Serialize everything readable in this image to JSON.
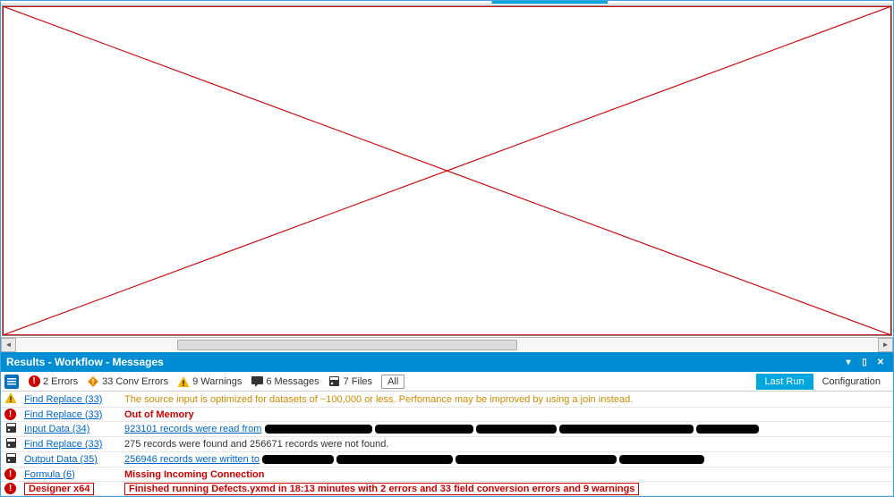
{
  "panel_title": "Results - Workflow - Messages",
  "filters": {
    "errors": "2 Errors",
    "conv": "33 Conv Errors",
    "warnings": "9 Warnings",
    "messages": "6 Messages",
    "files": "7 Files",
    "all": "All"
  },
  "tabs": {
    "last_run": "Last Run",
    "configuration": "Configuration"
  },
  "messages": [
    {
      "kind": "warn",
      "tool": "Find Replace (33)",
      "text": "The source input is optimized for datasets of ~100,000 or less.  Perfomance may be improved by using a join instead."
    },
    {
      "kind": "error",
      "tool": "Find Replace (33)",
      "text": "Out of Memory"
    },
    {
      "kind": "save",
      "tool": "Input Data (34)",
      "text": "923101 records were read from",
      "hasRedact": true
    },
    {
      "kind": "save",
      "tool": "Find Replace (33)",
      "text": "275 records were found and 256671 records were not found.",
      "plain": true
    },
    {
      "kind": "save",
      "tool": "Output Data (35)",
      "text": "256946 records were written to",
      "hasRedact": true,
      "longRedact": true
    },
    {
      "kind": "error",
      "tool": "Formula (6)",
      "text": "Missing Incoming Connection"
    },
    {
      "kind": "finish",
      "tool": "Designer x64",
      "text": "Finished running Defects.yxmd in 18:13 minutes with 2 errors and 33 field conversion errors and 9 warnings"
    }
  ]
}
